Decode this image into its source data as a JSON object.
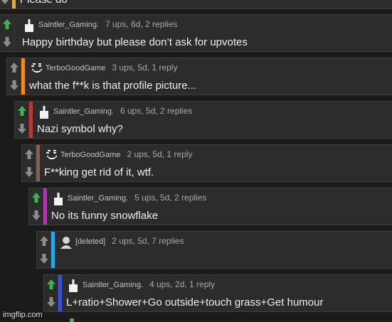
{
  "top_partial": {
    "text": "Please do",
    "stripe_color": "#f5a623"
  },
  "comments": [
    {
      "user": "Saintler_Gaming.",
      "info": "7 ups, 6d, 2 replies",
      "text": "Happy birthday but please don’t ask for upvotes",
      "stripe_color": "#2b2b2b",
      "upvoted": true,
      "avatar_icon": "bottle-icon"
    },
    {
      "user": "TerboGoodGame",
      "info": "3 ups, 5d, 1 reply",
      "text": "what the f**k is that profile picture...",
      "stripe_color": "#f28c18",
      "upvoted": false,
      "avatar_icon": "pixel-face-icon"
    },
    {
      "user": "Saintler_Gaming.",
      "info": "6 ups, 5d, 2 replies",
      "text": "Nazi symbol why?",
      "stripe_color": "#e02a2a",
      "upvoted": true,
      "avatar_icon": "bottle-icon"
    },
    {
      "user": "TerboGoodGame",
      "info": "2 ups, 5d, 1 reply",
      "text": "F**king get rid of it, wtf.",
      "stripe_color": "#8e5a5a",
      "upvoted": false,
      "avatar_icon": "pixel-face-icon"
    },
    {
      "user": "Saintler_Gaming.",
      "info": "5 ups, 5d, 2 replies",
      "text": "No its funny snowflake",
      "stripe_color": "#c02ac0",
      "upvoted": true,
      "avatar_icon": "bottle-icon"
    },
    {
      "user": "[deleted]",
      "info": "2 ups, 5d, 7 replies",
      "text": "",
      "stripe_color": "#29a6e6",
      "upvoted": false,
      "avatar_icon": "default-user-icon"
    },
    {
      "user": "Saintler_Gaming.",
      "info": "4 ups, 2d, 1 reply",
      "text": "L+ratio+Shower+Go outside+touch grass+Get humour",
      "stripe_color": "#3b4fd8",
      "upvoted": true,
      "avatar_icon": "bottle-icon"
    }
  ],
  "watermark": "imgflip.com",
  "colors": {
    "upvote_active": "#39b54a",
    "vote_inactive": "#8c8c8c"
  }
}
